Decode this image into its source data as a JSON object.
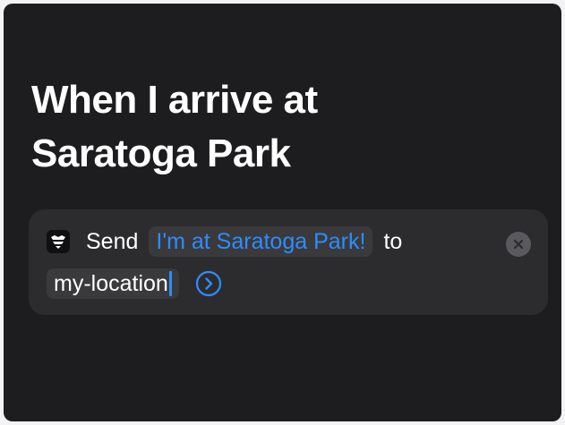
{
  "automation": {
    "title_line1": "When I arrive at",
    "title_line2": "Saratoga Park"
  },
  "action": {
    "app_icon": "messages-app-icon",
    "verb": "Send",
    "message": "I'm at Saratoga Park!",
    "preposition": "to",
    "recipient": "my-location",
    "close_icon": "close-icon",
    "expand_icon": "chevron-right-circle-icon"
  },
  "colors": {
    "background": "#1d1d1f",
    "card": "#2c2c2e",
    "token": "#3a3a3c",
    "accent": "#2f8cff",
    "text": "#ffffff"
  }
}
